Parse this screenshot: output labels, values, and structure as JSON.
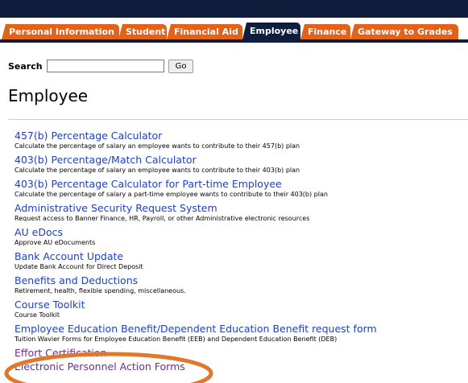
{
  "tabs": [
    {
      "label": "Personal Information",
      "active": false
    },
    {
      "label": "Student",
      "active": false
    },
    {
      "label": "Financial Aid",
      "active": false
    },
    {
      "label": "Employee",
      "active": true
    },
    {
      "label": "Finance",
      "active": false
    },
    {
      "label": "Gateway to Grades",
      "active": false
    }
  ],
  "search": {
    "label": "Search",
    "value": "",
    "go_label": "Go"
  },
  "page": {
    "title": "Employee"
  },
  "items": [
    {
      "link": "457(b) Percentage Calculator",
      "desc": "Calculate the percentage of salary an employee wants to contribute to their 457(b) plan"
    },
    {
      "link": "403(b) Percentage/Match Calculator",
      "desc": "Calculate the percentage of salary an employee wants to contribute to their 403(b) plan"
    },
    {
      "link": "403(b) Percentage Calculator for Part-time Employee",
      "desc": "Calculate the percentage of salary a part-time employee wants to contribute to their 403(b) plan"
    },
    {
      "link": "Administrative Security Request System",
      "desc": "Request access to Banner Finance, HR, Payroll, or other Administrative electronic resources"
    },
    {
      "link": "AU eDocs",
      "desc": "Approve AU eDocuments"
    },
    {
      "link": "Bank Account Update",
      "desc": "Update Bank Account for Direct Deposit"
    },
    {
      "link": "Benefits and Deductions",
      "desc": "Retirement, health, flexible spending, miscellaneous."
    },
    {
      "link": "Course Toolkit",
      "desc": "Course Toolkit"
    },
    {
      "link": "Employee Education Benefit/Dependent Education Benefit request form",
      "desc": "Tuition Wavier Forms for Employee Education Benefit (EEB) and Dependent Education Benefit (DEB)"
    },
    {
      "link": "Effort Certification",
      "desc": ""
    },
    {
      "link": "Electronic Personnel Action Forms",
      "desc": ""
    }
  ],
  "colors": {
    "nav": "#0f1e3c",
    "tab": "#e2611b",
    "link": "#1f41c2",
    "visited_link": "#6e2a9c",
    "highlight": "#e0782c"
  }
}
